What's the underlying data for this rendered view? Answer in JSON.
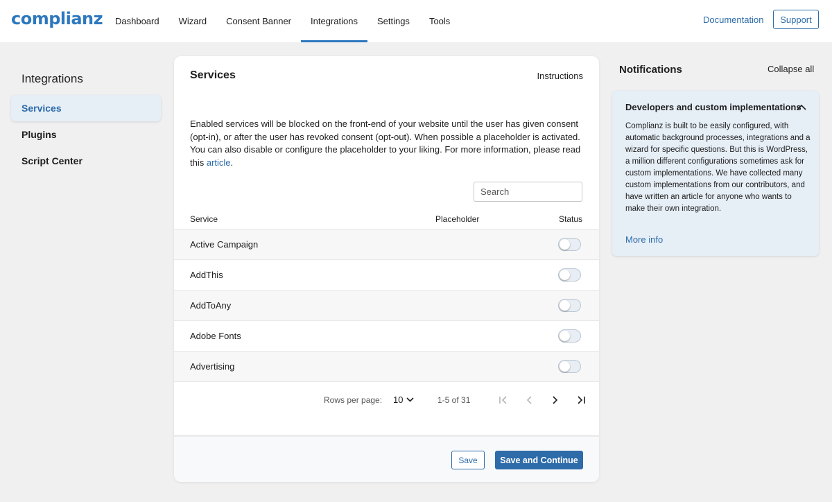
{
  "header": {
    "logo": "complianz",
    "nav": [
      "Dashboard",
      "Wizard",
      "Consent Banner",
      "Integrations",
      "Settings",
      "Tools"
    ],
    "active_nav": "Integrations",
    "documentation": "Documentation",
    "support": "Support"
  },
  "sidebar": {
    "title": "Integrations",
    "items": [
      {
        "label": "Services",
        "active": true
      },
      {
        "label": "Plugins",
        "active": false
      },
      {
        "label": "Script Center",
        "active": false
      }
    ]
  },
  "services": {
    "title": "Services",
    "instructions": "Instructions",
    "intro": "Enabled services will be blocked on the front-end of your website until the user has given consent (opt-in), or after the user has revoked consent (opt-out). When possible a placeholder is activated. You can also disable or configure the placeholder to your liking. For more information, please read this ",
    "intro_link": "article",
    "intro_end": ".",
    "search_placeholder": "Search",
    "columns": {
      "service": "Service",
      "placeholder": "Placeholder",
      "status": "Status"
    },
    "rows": [
      {
        "name": "Active Campaign",
        "enabled": false
      },
      {
        "name": "AddThis",
        "enabled": false
      },
      {
        "name": "AddToAny",
        "enabled": false
      },
      {
        "name": "Adobe Fonts",
        "enabled": false
      },
      {
        "name": "Advertising",
        "enabled": false
      }
    ],
    "pagination": {
      "rows_per_page_label": "Rows per page:",
      "rows_per_page": "10",
      "range": "1-5 of 31"
    },
    "save": "Save",
    "save_continue": "Save and Continue"
  },
  "notifications": {
    "title": "Notifications",
    "collapse_all": "Collapse all",
    "item": {
      "title": "Developers and custom implementations",
      "body": "Complianz is built to be easily configured, with automatic background processes, integrations and a wizard for specific questions. But this is WordPress, a million different configurations sometimes ask for custom implementations. We have collected many custom implementations from our contributors, and have written an article for anyone who wants to make their own integration.",
      "more_info": "More info"
    }
  },
  "colors": {
    "accent": "#2d6ba9",
    "brand": "#2d78be",
    "background": "#f0f0f1"
  }
}
